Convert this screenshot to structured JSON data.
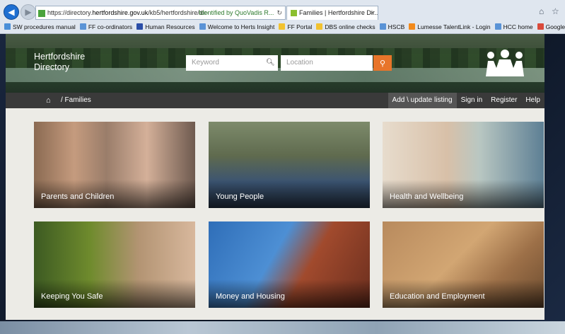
{
  "browser": {
    "url_prefix": "https://directory.",
    "url_host": "hertfordshire.gov.uk",
    "url_rest": "/kb5/hertfordshire/dir- ",
    "identity": "Identified by QuoVadis R...",
    "tab_title": "Families | Hertfordshire Dir...",
    "favorites": [
      {
        "label": "SW procedures manual",
        "color": "#4a8fd8"
      },
      {
        "label": "FF co-ordinators",
        "color": "#5a93d6"
      },
      {
        "label": "Human Resources",
        "color": "#2b4ea8"
      },
      {
        "label": "Welcome to Herts Insight",
        "color": "#5a93d6"
      },
      {
        "label": "FF Portal",
        "color": "#f2c230"
      },
      {
        "label": "DBS online checks",
        "color": "#f2c230"
      },
      {
        "label": "HSCB",
        "color": "#5a93d6"
      },
      {
        "label": "Lumesse TalentLink - Login",
        "color": "#f28a1c"
      },
      {
        "label": "HCC home",
        "color": "#5a93d6"
      },
      {
        "label": "Google",
        "color": "#d94a3b"
      }
    ]
  },
  "header": {
    "brand_line1": "Hertfordshire",
    "brand_line2": "Directory",
    "keyword_placeholder": "Keyword",
    "location_placeholder": "Location"
  },
  "nav": {
    "breadcrumb": "/ Families",
    "add_listing": "Add \\ update listing",
    "sign_in": "Sign in",
    "register": "Register",
    "help": "Help"
  },
  "cards": [
    "Parents and Children",
    "Young People",
    "Health and Wellbeing",
    "Keeping You Safe",
    "Money and Housing",
    "Education and Employment"
  ],
  "colors": {
    "accent": "#e8752a",
    "nav_bar": "#3a3a3a",
    "page_bg": "#ecebe6"
  }
}
